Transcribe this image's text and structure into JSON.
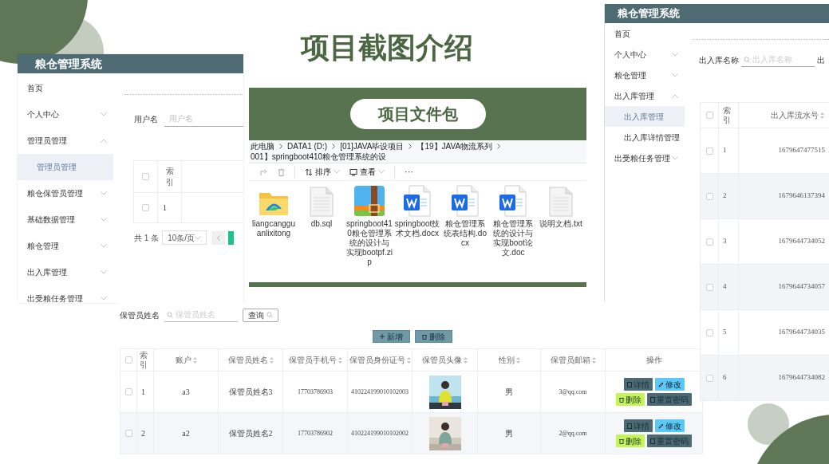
{
  "title": "项目截图介绍",
  "admin_window": {
    "app_title": "粮仓管理系统",
    "sidebar": [
      {
        "label": "首页",
        "kind": "link"
      },
      {
        "label": "个人中心",
        "kind": "menu",
        "expanded": false
      },
      {
        "label": "管理员管理",
        "kind": "menu",
        "expanded": true,
        "children": [
          {
            "label": "管理员管理",
            "selected": true
          }
        ]
      },
      {
        "label": "粮仓保管员管理",
        "kind": "menu",
        "expanded": false
      },
      {
        "label": "基础数据管理",
        "kind": "menu",
        "expanded": false
      },
      {
        "label": "粮仓管理",
        "kind": "menu",
        "expanded": false
      },
      {
        "label": "出入库管理",
        "kind": "menu",
        "expanded": false
      },
      {
        "label": "出受粮任务管理",
        "kind": "menu",
        "expanded": false
      }
    ],
    "search": {
      "label": "用户名",
      "placeholder": "用户名"
    },
    "table": {
      "columns": [
        "索引"
      ],
      "header_checked": false,
      "rows": [
        {
          "index": "1",
          "checked": false
        }
      ]
    },
    "pagination": {
      "total": "共 1 条",
      "page_size": "10条/页"
    }
  },
  "file_package": {
    "badge": "项目文件包",
    "breadcrumb": [
      "此电脑",
      "DATA1 (D:)",
      "[01]JAVA毕设项目",
      "【19】JAVA物流系列",
      "001】springboot410粮仓管理系统的设"
    ],
    "toolbar": [
      {
        "label": "排序",
        "kind": "sort"
      },
      {
        "label": "查看",
        "kind": "view"
      }
    ],
    "more": "···",
    "files": [
      {
        "name": "liangcangguanlixitong",
        "kind": "folder"
      },
      {
        "name": "db.sql",
        "kind": "text"
      },
      {
        "name": "springboot410粮仓管理系统的设计与实现bootpf.zip",
        "kind": "zip"
      },
      {
        "name": "springboot技术文档.docx",
        "kind": "word"
      },
      {
        "name": "粮仓管理系统表结构.docx",
        "kind": "word"
      },
      {
        "name": "粮仓管理系统的设计与实现boot论文.doc",
        "kind": "word"
      },
      {
        "name": "说明文档.txt",
        "kind": "text"
      }
    ]
  },
  "stock_window": {
    "app_title": "粮仓管理系统",
    "sidebar": [
      {
        "label": "首页",
        "kind": "link"
      },
      {
        "label": "个人中心",
        "kind": "menu",
        "expanded": false
      },
      {
        "label": "粮仓管理",
        "kind": "menu",
        "expanded": false
      },
      {
        "label": "出入库管理",
        "kind": "menu",
        "expanded": true,
        "children": [
          {
            "label": "出入库管理",
            "selected": true
          },
          {
            "label": "出入库详情管理",
            "selected": false
          }
        ]
      },
      {
        "label": "出受粮任务管理",
        "kind": "menu",
        "expanded": false
      }
    ],
    "search": {
      "label": "出入库名称",
      "placeholder": "出入库名称",
      "next_label": "出"
    },
    "table": {
      "columns": [
        "索引",
        "出入库流水号"
      ],
      "header_checked": false,
      "rows": [
        {
          "index": "1",
          "serial": "1679647477515",
          "checked": false
        },
        {
          "index": "2",
          "serial": "1679646137394",
          "checked": false
        },
        {
          "index": "3",
          "serial": "1679644734052",
          "checked": false
        },
        {
          "index": "4",
          "serial": "1679644734057",
          "checked": false
        },
        {
          "index": "5",
          "serial": "1679644734035",
          "checked": false
        },
        {
          "index": "6",
          "serial": "1679644734082",
          "checked": false
        }
      ]
    }
  },
  "keeper_window": {
    "search": {
      "label": "保管员姓名",
      "placeholder": "保管员姓名",
      "button": "查询"
    },
    "actions": [
      {
        "label": "新增",
        "kind": "add"
      },
      {
        "label": "删除",
        "kind": "delete"
      }
    ],
    "header_checked": false,
    "columns": [
      {
        "label": "索引",
        "sortable": false
      },
      {
        "label": "账户",
        "sortable": true
      },
      {
        "label": "保管员姓名",
        "sortable": true
      },
      {
        "label": "保管员手机号",
        "sortable": true
      },
      {
        "label": "保管员身份证号",
        "sortable": true
      },
      {
        "label": "保管员头像",
        "sortable": true
      },
      {
        "label": "性别",
        "sortable": true
      },
      {
        "label": "保管员邮箱",
        "sortable": true
      },
      {
        "label": "操作",
        "sortable": false
      }
    ],
    "rows": [
      {
        "index": "1",
        "account": "a3",
        "name": "保管员姓名3",
        "phone": "17703786903",
        "id_card": "410224199010102003",
        "avatar": {
          "kind": "picture"
        },
        "gender": "男",
        "email": "3@qq.com",
        "checked": false,
        "actions": [
          {
            "label": "详情",
            "kind": "detail"
          },
          {
            "label": "修改",
            "kind": "edit"
          },
          {
            "label": "删除",
            "kind": "delete"
          },
          {
            "label": "重置密码",
            "kind": "reset"
          }
        ]
      },
      {
        "index": "2",
        "account": "a2",
        "name": "保管员姓名2",
        "phone": "17703786902",
        "id_card": "410224199010102002",
        "avatar": {
          "kind": "picture"
        },
        "gender": "男",
        "email": "2@qq.com",
        "checked": false,
        "actions": [
          {
            "label": "详情",
            "kind": "detail"
          },
          {
            "label": "修改",
            "kind": "edit"
          },
          {
            "label": "删除",
            "kind": "delete"
          },
          {
            "label": "重置密码",
            "kind": "reset"
          }
        ]
      }
    ]
  }
}
